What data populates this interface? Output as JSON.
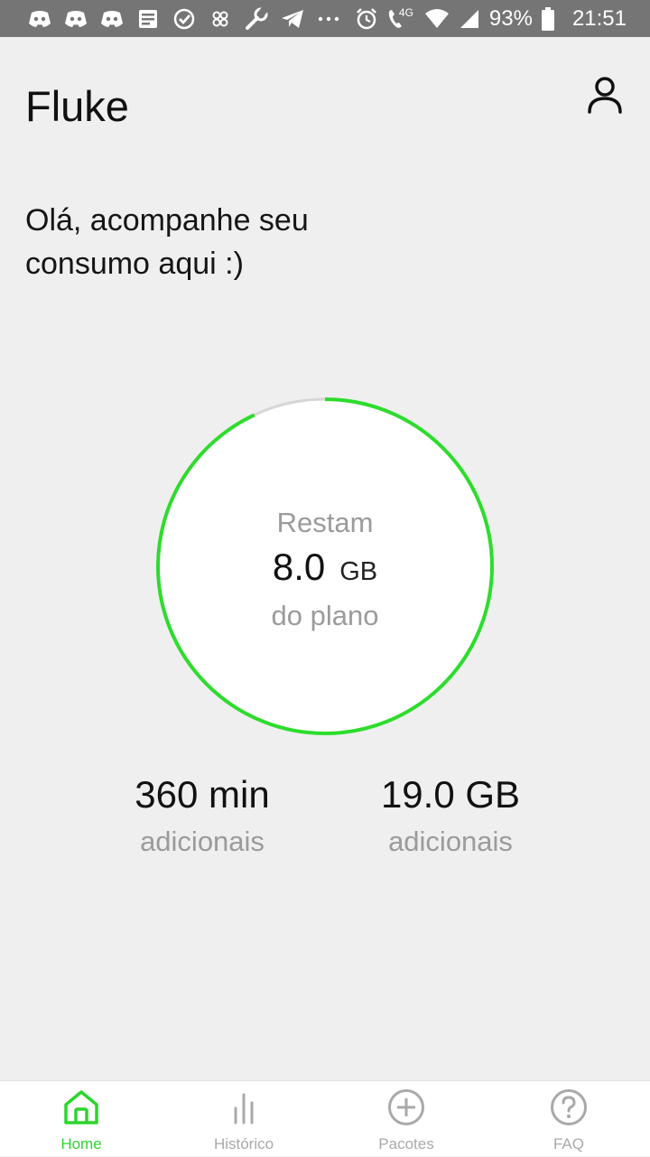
{
  "status_bar": {
    "icons": [
      "discord-icon",
      "discord-icon",
      "discord-icon",
      "news-icon",
      "check-circle-icon",
      "cloverleaf-icon",
      "wrench-icon",
      "telegram-icon",
      "more-dots-icon"
    ],
    "network_label": "4G",
    "battery_percent": "93%",
    "time": "21:51"
  },
  "header": {
    "title": "Fluke",
    "profile_icon": "user-icon"
  },
  "greeting": {
    "line1": "Olá, acompanhe seu",
    "line2": "consumo aqui :)"
  },
  "plan_gauge": {
    "caption_top": "Restam",
    "value": "8.0",
    "unit": "GB",
    "caption_bottom": "do plano",
    "remaining_fraction": 0.93,
    "colors": {
      "progress": "#2ddc2d",
      "track": "#d6d6d6",
      "fill": "#ffffff"
    }
  },
  "extras": {
    "minutes": {
      "value": "360 min",
      "label": "adicionais"
    },
    "data": {
      "value": "19.0 GB",
      "label": "adicionais"
    }
  },
  "bottom_nav": {
    "active_color": "#2bd62b",
    "inactive_color": "#a9a9a9",
    "items": [
      {
        "label": "Home",
        "icon": "home-icon",
        "active": true
      },
      {
        "label": "Histórico",
        "icon": "bar-chart-icon",
        "active": false
      },
      {
        "label": "Pacotes",
        "icon": "plus-circle-icon",
        "active": false
      },
      {
        "label": "FAQ",
        "icon": "question-circle-icon",
        "active": false
      }
    ]
  }
}
